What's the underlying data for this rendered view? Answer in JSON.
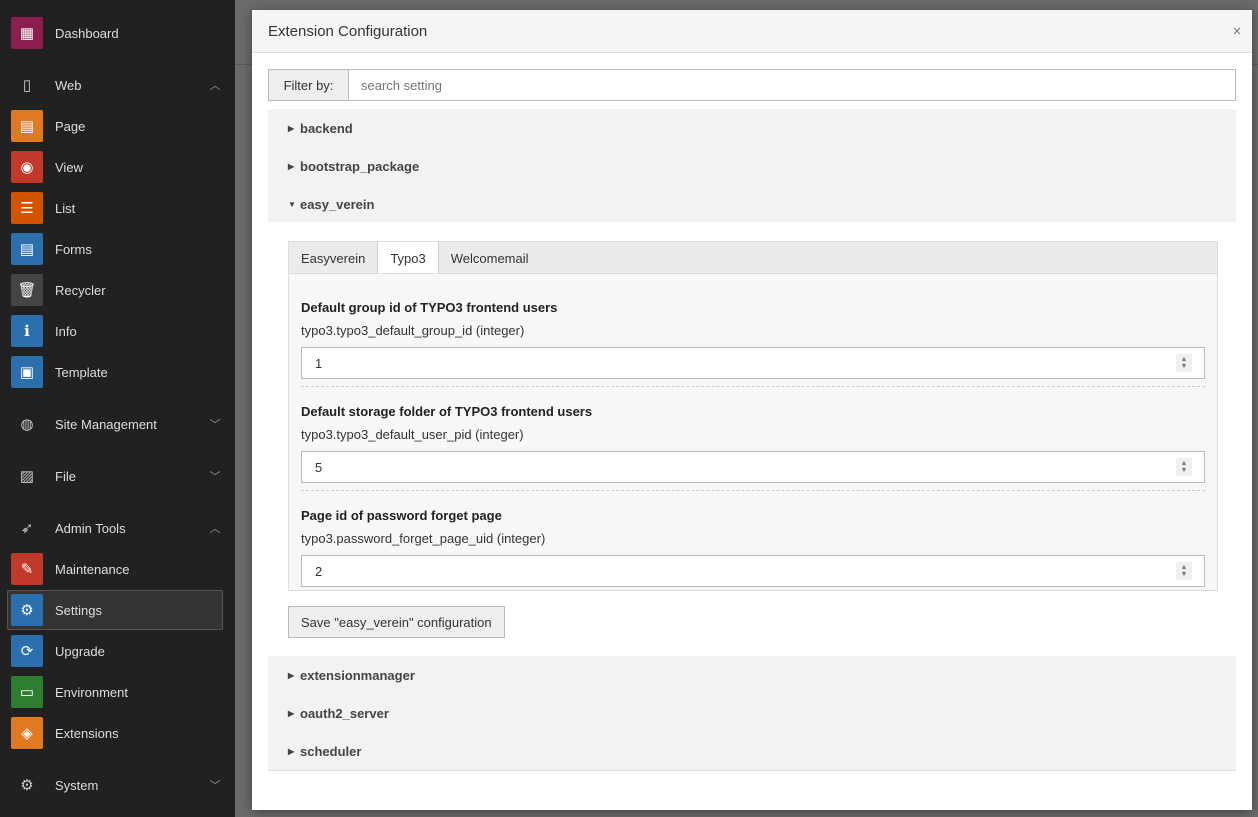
{
  "sidebar": {
    "dashboard": "Dashboard",
    "web": "Web",
    "page": "Page",
    "view": "View",
    "list": "List",
    "forms": "Forms",
    "recycler": "Recycler",
    "info": "Info",
    "template": "Template",
    "site_management": "Site Management",
    "file": "File",
    "admin_tools": "Admin Tools",
    "maintenance": "Maintenance",
    "settings": "Settings",
    "upgrade": "Upgrade",
    "environment": "Environment",
    "extensions": "Extensions",
    "system": "System"
  },
  "modal": {
    "title": "Extension Configuration",
    "close": "×",
    "filter_label": "Filter by:",
    "filter_placeholder": "search setting"
  },
  "extensions_top": [
    "backend",
    "bootstrap_package",
    "easy_verein"
  ],
  "extensions_bottom": [
    "extensionmanager",
    "oauth2_server",
    "scheduler"
  ],
  "tabs": [
    "Easyverein",
    "Typo3",
    "Welcomemail"
  ],
  "active_tab": "Typo3",
  "settings": [
    {
      "title": "Default group id of TYPO3 frontend users",
      "key": "typo3.typo3_default_group_id (integer)",
      "value": "1"
    },
    {
      "title": "Default storage folder of TYPO3 frontend users",
      "key": "typo3.typo3_default_user_pid (integer)",
      "value": "5"
    },
    {
      "title": "Page id of password forget page",
      "key": "typo3.password_forget_page_uid (integer)",
      "value": "2"
    }
  ],
  "save_label": "Save \"easy_verein\" configuration",
  "colors": {
    "dashboard": "#8b1e4f",
    "page": "#e07a22",
    "view": "#c0392b",
    "list": "#d35400",
    "forms": "#2c6fad",
    "recycler": "#444444",
    "info": "#2c6fad",
    "template": "#2c6fad",
    "maintenance": "#c0392b",
    "settings": "#2c6fad",
    "upgrade": "#2c6fad",
    "environment": "#2e7d32",
    "extensions": "#e07a22"
  }
}
